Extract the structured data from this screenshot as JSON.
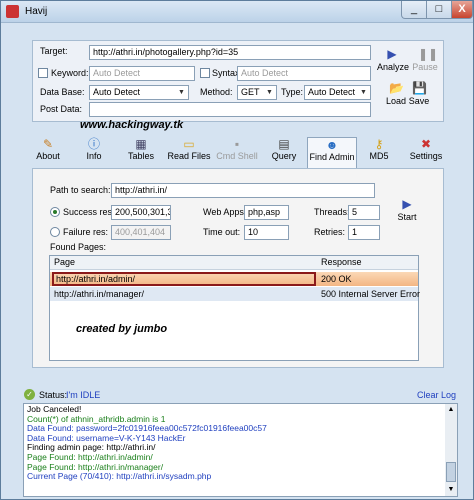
{
  "window": {
    "title": "Havij",
    "minimize": "_",
    "maximize": "□",
    "close": "X"
  },
  "target": {
    "label": "Target:",
    "value": "http://athri.in/photogallery.php?id=35",
    "keyword_label": "Keyword:",
    "keyword_placeholder": "Auto Detect",
    "syntax_label": "Syntax:",
    "syntax_placeholder": "Auto Detect",
    "database_label": "Data Base:",
    "database_value": "Auto Detect",
    "method_label": "Method:",
    "method_value": "GET",
    "type_label": "Type:",
    "type_value": "Auto Detect",
    "post_data_label": "Post Data:",
    "post_data_value": ""
  },
  "actions": {
    "analyze": "Analyze",
    "pause": "Pause",
    "load": "Load",
    "save": "Save"
  },
  "watermark_site": "www.hackingway.tk",
  "tabs": [
    {
      "label": "About",
      "icon": "wrench-icon"
    },
    {
      "label": "Info",
      "icon": "info-icon"
    },
    {
      "label": "Tables",
      "icon": "tables-icon"
    },
    {
      "label": "Read Files",
      "icon": "folder-icon"
    },
    {
      "label": "Cmd Shell",
      "icon": "shell-icon"
    },
    {
      "label": "Query",
      "icon": "query-icon"
    },
    {
      "label": "Find Admin",
      "icon": "find-admin-icon"
    },
    {
      "label": "MD5",
      "icon": "key-icon"
    },
    {
      "label": "Settings",
      "icon": "tools-icon"
    }
  ],
  "find_admin": {
    "path_label": "Path to search:",
    "path_value": "http://athri.in/",
    "success_label": "Success res:",
    "success_value": "200,500,301,3",
    "failure_label": "Failure res:",
    "failure_value": "400,401,404",
    "webapps_label": "Web Apps:",
    "webapps_value": "php,asp",
    "timeout_label": "Time out:",
    "timeout_value": "10",
    "threads_label": "Threads:",
    "threads_value": "5",
    "retries_label": "Retries:",
    "retries_value": "1",
    "start_label": "Start",
    "found_pages_label": "Found Pages:",
    "columns": [
      "Page",
      "Response"
    ],
    "rows": [
      {
        "page": "http://athri.in/admin/",
        "response": "200 OK"
      },
      {
        "page": "http://athri.in/manager/",
        "response": "500 Internal Server Error"
      }
    ],
    "overlay_text": "created by jumbo"
  },
  "status": {
    "label": "Status:",
    "value": "I'm IDLE",
    "clear_log": "Clear Log"
  },
  "log_lines": [
    {
      "text": "Job Canceled!",
      "color": "#000000"
    },
    {
      "text": "Count(*) of athnin_athridb.admin is 1",
      "color": "#1a7f1a"
    },
    {
      "text": "Data Found: password=2fc01916feea00c572fc01916feea00c57",
      "color": "#1f3fbf"
    },
    {
      "text": "Data Found: username=V-K-Y143 HackEr",
      "color": "#1f3fbf"
    },
    {
      "text": "Finding admin page: http://athri.in/",
      "color": "#000000"
    },
    {
      "text": "Page Found: http://athri.in/admin/",
      "color": "#1a7f1a"
    },
    {
      "text": "Page Found: http://athri.in/manager/",
      "color": "#1a7f1a"
    },
    {
      "text": "Current Page (70/410): http://athri.in/sysadm.php",
      "color": "#1f3fbf"
    }
  ],
  "colors": {
    "highlight_row": "#f7c79e",
    "highlight_border": "#8b1a1a",
    "second_row": "#dfe8f3"
  }
}
